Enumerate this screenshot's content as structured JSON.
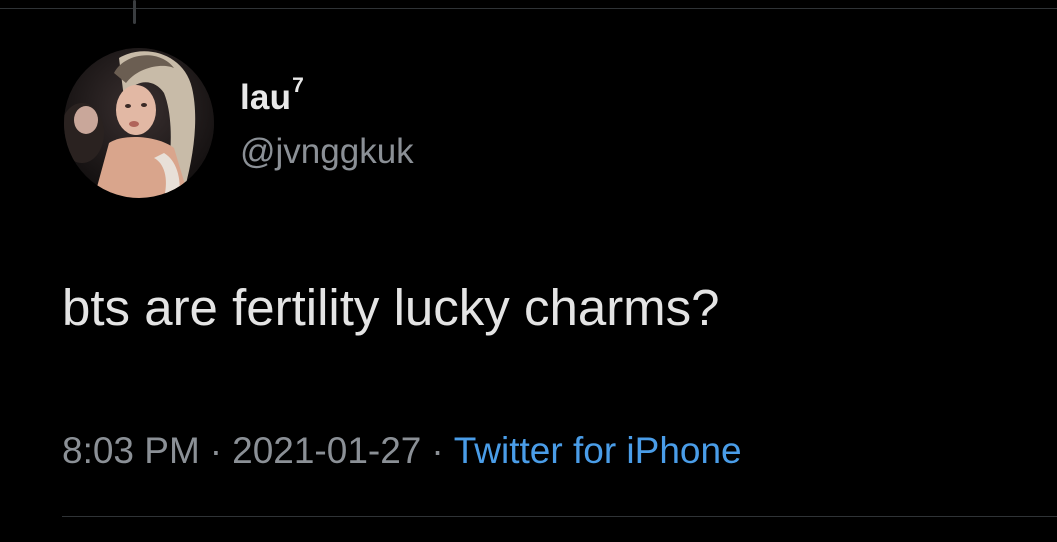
{
  "tweet": {
    "author": {
      "display_name": "lau",
      "display_name_superscript": "7",
      "handle": "@jvnggkuk",
      "avatar_icon": "profile-photo"
    },
    "text": "bts are fertility lucky charms?",
    "time": "8:03 PM",
    "date": "2021-01-27",
    "separator": "·",
    "source": "Twitter for iPhone"
  },
  "colors": {
    "background": "#000000",
    "primary_text": "#e4e4e4",
    "secondary_text": "#8b9096",
    "link": "#4a9de8",
    "divider": "#2f3336"
  }
}
